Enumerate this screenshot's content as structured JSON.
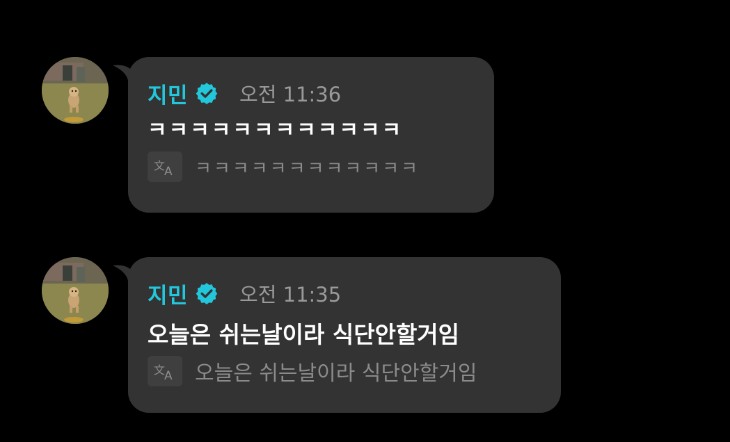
{
  "messages": [
    {
      "sender": "지민",
      "time": "오전 11:36",
      "text": "ㅋㅋㅋㅋㅋㅋㅋㅋㅋㅋㅋㅋ",
      "translation": "ㅋㅋㅋㅋㅋㅋㅋㅋㅋㅋㅋㅋ"
    },
    {
      "sender": "지민",
      "time": "오전 11:35",
      "text": "오늘은 쉬는날이라 식단안할거임",
      "translation": "오늘은 쉬는날이라 식단안할거임"
    }
  ],
  "icons": {
    "verified": "verified-badge-icon",
    "translate": "translate-icon",
    "avatar": "avatar-dog-photo"
  },
  "colors": {
    "background": "#000000",
    "bubble": "#333333",
    "name": "#22c7dc",
    "time": "#9a9a9a",
    "translation": "#8b8b8b"
  }
}
